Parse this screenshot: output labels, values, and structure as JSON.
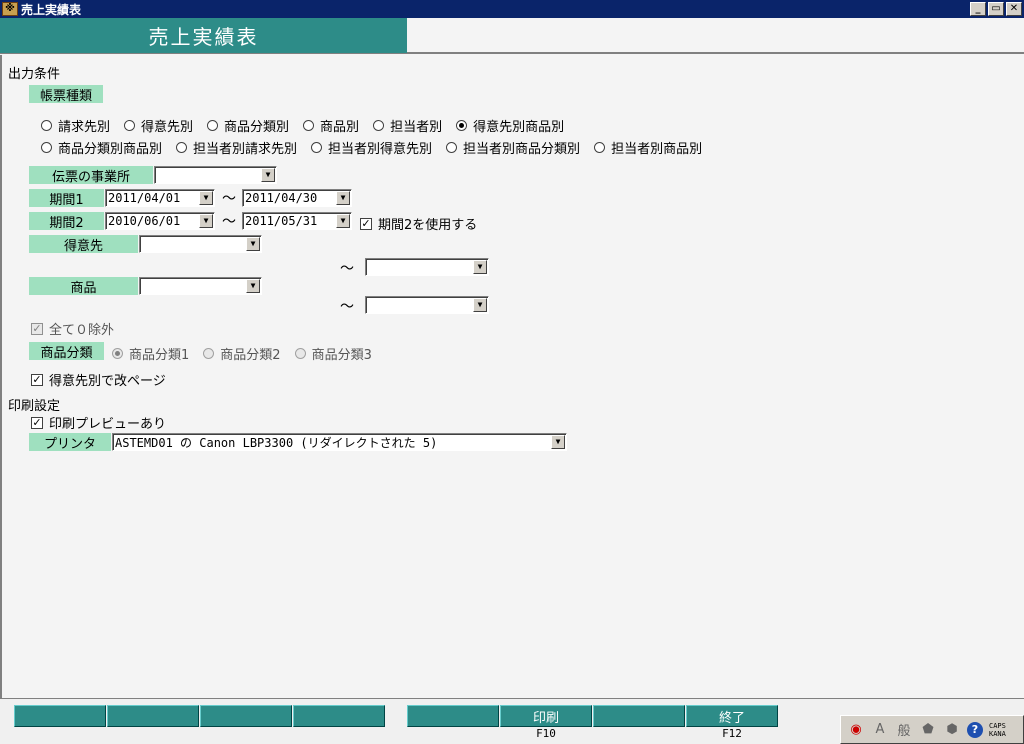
{
  "window": {
    "title": "売上実績表"
  },
  "header": {
    "title": "売上実績表"
  },
  "output_conditions": {
    "section_label": "出力条件",
    "report_type_label": "帳票種類",
    "report_types_row1": [
      "請求先別",
      "得意先別",
      "商品分類別",
      "商品別",
      "担当者別",
      "得意先別商品別"
    ],
    "report_types_row2": [
      "商品分類別商品別",
      "担当者別請求先別",
      "担当者別得意先別",
      "担当者別商品分類別",
      "担当者別商品別"
    ],
    "selected_report_type": "得意先別商品別",
    "office_label": "伝票の事業所",
    "office_value": "",
    "period1_label": "期間1",
    "period1_from": "2011/04/01",
    "period1_to": "2011/04/30",
    "period2_label": "期間2",
    "period2_from": "2010/06/01",
    "period2_to": "2011/05/31",
    "use_period2_label": "期間2を使用する",
    "tilde": "～",
    "customer_label": "得意先",
    "customer_from": "",
    "customer_to": "",
    "product_label": "商品",
    "product_from": "",
    "product_to": "",
    "exclude_zero_label": "全て０除外",
    "category_label": "商品分類",
    "category_options": [
      "商品分類1",
      "商品分類2",
      "商品分類3"
    ],
    "page_break_label": "得意先別で改ページ"
  },
  "print_settings": {
    "section_label": "印刷設定",
    "preview_label": "印刷プレビューあり",
    "printer_label": "プリンタ",
    "printer_value": "ASTEMD01 の Canon LBP3300 (リダイレクトされた 5)"
  },
  "fkeys": {
    "print_label": "印刷",
    "print_key": "F10",
    "exit_label": "終了",
    "exit_key": "F12"
  },
  "ime": {
    "kanji": "般",
    "mode": "A",
    "caps": "CAPS",
    "kana": "KANA",
    "help": "?"
  }
}
